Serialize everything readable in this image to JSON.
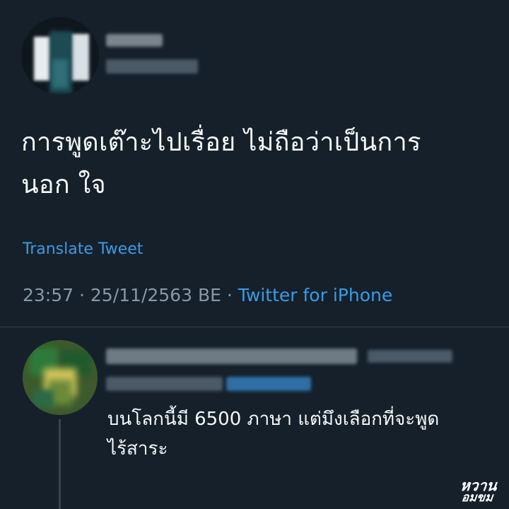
{
  "tweet": {
    "author_avatar_icon": "user-avatar-icon",
    "text_line1": "การพูดเต๊าะไปเรื่อย ไม่ถือว่าเป็นการ",
    "text_line2": "นอก ใจ",
    "translate_label": "Translate Tweet",
    "time": "23:57",
    "date": "25/11/2563 BE",
    "separator": "·",
    "source": "Twitter for iPhone"
  },
  "reply": {
    "author_avatar_icon": "user-avatar-icon",
    "text_line1": "บนโลกนี้มี 6500 ภาษา แต่มึงเลือกที่จะพูด",
    "text_line2": "ไร้สาระ"
  },
  "watermark": {
    "line1": "หวาน",
    "line2": "อมขม"
  },
  "colors": {
    "background": "#15202b",
    "text": "#f5f8fa",
    "muted": "#8899a6",
    "link": "#3a9be5",
    "divider": "#38444d"
  }
}
